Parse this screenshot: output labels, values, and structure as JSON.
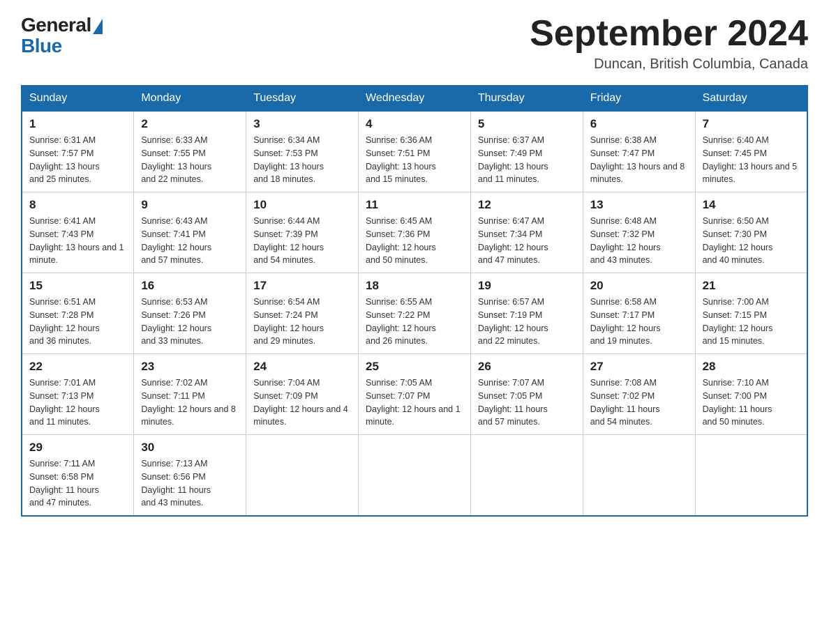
{
  "header": {
    "logo_general": "General",
    "logo_blue": "Blue",
    "month_title": "September 2024",
    "location": "Duncan, British Columbia, Canada"
  },
  "days_of_week": [
    "Sunday",
    "Monday",
    "Tuesday",
    "Wednesday",
    "Thursday",
    "Friday",
    "Saturday"
  ],
  "weeks": [
    [
      {
        "num": "1",
        "sunrise": "6:31 AM",
        "sunset": "7:57 PM",
        "daylight": "13 hours and 25 minutes."
      },
      {
        "num": "2",
        "sunrise": "6:33 AM",
        "sunset": "7:55 PM",
        "daylight": "13 hours and 22 minutes."
      },
      {
        "num": "3",
        "sunrise": "6:34 AM",
        "sunset": "7:53 PM",
        "daylight": "13 hours and 18 minutes."
      },
      {
        "num": "4",
        "sunrise": "6:36 AM",
        "sunset": "7:51 PM",
        "daylight": "13 hours and 15 minutes."
      },
      {
        "num": "5",
        "sunrise": "6:37 AM",
        "sunset": "7:49 PM",
        "daylight": "13 hours and 11 minutes."
      },
      {
        "num": "6",
        "sunrise": "6:38 AM",
        "sunset": "7:47 PM",
        "daylight": "13 hours and 8 minutes."
      },
      {
        "num": "7",
        "sunrise": "6:40 AM",
        "sunset": "7:45 PM",
        "daylight": "13 hours and 5 minutes."
      }
    ],
    [
      {
        "num": "8",
        "sunrise": "6:41 AM",
        "sunset": "7:43 PM",
        "daylight": "13 hours and 1 minute."
      },
      {
        "num": "9",
        "sunrise": "6:43 AM",
        "sunset": "7:41 PM",
        "daylight": "12 hours and 57 minutes."
      },
      {
        "num": "10",
        "sunrise": "6:44 AM",
        "sunset": "7:39 PM",
        "daylight": "12 hours and 54 minutes."
      },
      {
        "num": "11",
        "sunrise": "6:45 AM",
        "sunset": "7:36 PM",
        "daylight": "12 hours and 50 minutes."
      },
      {
        "num": "12",
        "sunrise": "6:47 AM",
        "sunset": "7:34 PM",
        "daylight": "12 hours and 47 minutes."
      },
      {
        "num": "13",
        "sunrise": "6:48 AM",
        "sunset": "7:32 PM",
        "daylight": "12 hours and 43 minutes."
      },
      {
        "num": "14",
        "sunrise": "6:50 AM",
        "sunset": "7:30 PM",
        "daylight": "12 hours and 40 minutes."
      }
    ],
    [
      {
        "num": "15",
        "sunrise": "6:51 AM",
        "sunset": "7:28 PM",
        "daylight": "12 hours and 36 minutes."
      },
      {
        "num": "16",
        "sunrise": "6:53 AM",
        "sunset": "7:26 PM",
        "daylight": "12 hours and 33 minutes."
      },
      {
        "num": "17",
        "sunrise": "6:54 AM",
        "sunset": "7:24 PM",
        "daylight": "12 hours and 29 minutes."
      },
      {
        "num": "18",
        "sunrise": "6:55 AM",
        "sunset": "7:22 PM",
        "daylight": "12 hours and 26 minutes."
      },
      {
        "num": "19",
        "sunrise": "6:57 AM",
        "sunset": "7:19 PM",
        "daylight": "12 hours and 22 minutes."
      },
      {
        "num": "20",
        "sunrise": "6:58 AM",
        "sunset": "7:17 PM",
        "daylight": "12 hours and 19 minutes."
      },
      {
        "num": "21",
        "sunrise": "7:00 AM",
        "sunset": "7:15 PM",
        "daylight": "12 hours and 15 minutes."
      }
    ],
    [
      {
        "num": "22",
        "sunrise": "7:01 AM",
        "sunset": "7:13 PM",
        "daylight": "12 hours and 11 minutes."
      },
      {
        "num": "23",
        "sunrise": "7:02 AM",
        "sunset": "7:11 PM",
        "daylight": "12 hours and 8 minutes."
      },
      {
        "num": "24",
        "sunrise": "7:04 AM",
        "sunset": "7:09 PM",
        "daylight": "12 hours and 4 minutes."
      },
      {
        "num": "25",
        "sunrise": "7:05 AM",
        "sunset": "7:07 PM",
        "daylight": "12 hours and 1 minute."
      },
      {
        "num": "26",
        "sunrise": "7:07 AM",
        "sunset": "7:05 PM",
        "daylight": "11 hours and 57 minutes."
      },
      {
        "num": "27",
        "sunrise": "7:08 AM",
        "sunset": "7:02 PM",
        "daylight": "11 hours and 54 minutes."
      },
      {
        "num": "28",
        "sunrise": "7:10 AM",
        "sunset": "7:00 PM",
        "daylight": "11 hours and 50 minutes."
      }
    ],
    [
      {
        "num": "29",
        "sunrise": "7:11 AM",
        "sunset": "6:58 PM",
        "daylight": "11 hours and 47 minutes."
      },
      {
        "num": "30",
        "sunrise": "7:13 AM",
        "sunset": "6:56 PM",
        "daylight": "11 hours and 43 minutes."
      },
      null,
      null,
      null,
      null,
      null
    ]
  ],
  "labels": {
    "sunrise": "Sunrise:",
    "sunset": "Sunset:",
    "daylight": "Daylight:"
  }
}
